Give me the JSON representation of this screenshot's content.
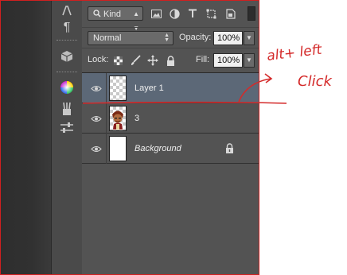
{
  "filter": {
    "kind_label": "Kind"
  },
  "blending": {
    "mode": "Normal",
    "opacity_label": "Opacity:",
    "opacity_value": "100%"
  },
  "lock": {
    "label": "Lock:",
    "fill_label": "Fill:",
    "fill_value": "100%"
  },
  "layers": [
    {
      "name": "Layer 1",
      "selected": true,
      "visible": true,
      "thumbnail": "transparent"
    },
    {
      "name": "3",
      "selected": false,
      "visible": true,
      "thumbnail": "character"
    },
    {
      "name": "Background",
      "selected": false,
      "visible": true,
      "thumbnail": "white",
      "locked": true,
      "italic": true
    }
  ],
  "annotation": {
    "line1": "alt+ left",
    "line2": "Click",
    "color": "#d42a2a"
  },
  "colors": {
    "selection": "#5c6877",
    "panel": "#535353",
    "frame": "#d02020"
  }
}
